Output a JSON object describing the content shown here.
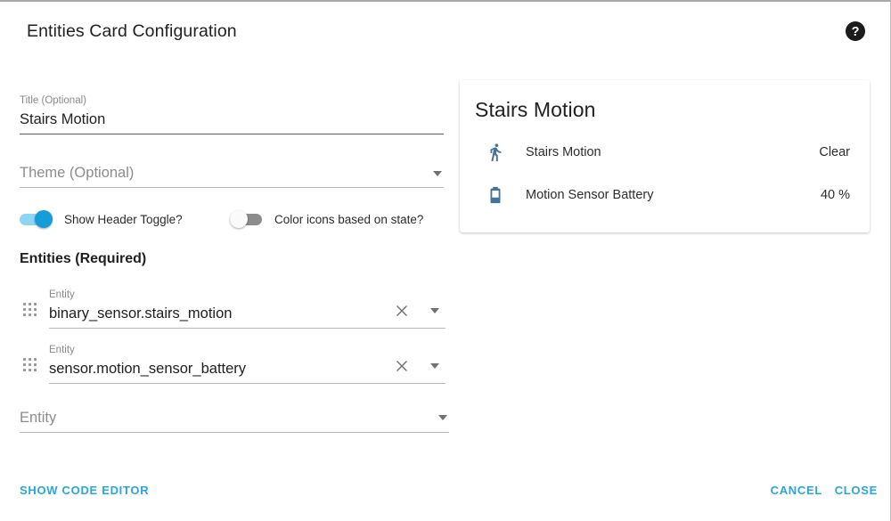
{
  "dialog": {
    "title": "Entities Card Configuration",
    "help_icon": "help-circle-icon"
  },
  "form": {
    "title_field": {
      "label": "Title (Optional)",
      "value": "Stairs Motion"
    },
    "theme_field": {
      "label": "Theme (Optional)",
      "placeholder": "Theme (Optional)",
      "value": "",
      "dropdown_icon": "chevron-down-icon"
    },
    "toggles": [
      {
        "label": "Show Header Toggle?",
        "state": "on",
        "on_color": "#169dd8",
        "track_color": "#8ed5f5"
      },
      {
        "label": "Color icons based on state?",
        "state": "off",
        "off_color": "#8c8c8c"
      }
    ],
    "entities_heading": "Entities (Required)",
    "entity_rows": [
      {
        "label": "Entity",
        "value": "binary_sensor.stairs_motion",
        "clear_icon": "close-icon",
        "dropdown_icon": "chevron-down-icon",
        "drag_icon": "drag-handle-icon"
      },
      {
        "label": "Entity",
        "value": "sensor.motion_sensor_battery",
        "clear_icon": "close-icon",
        "dropdown_icon": "chevron-down-icon",
        "drag_icon": "drag-handle-icon"
      }
    ],
    "entity_empty": {
      "placeholder": "Entity",
      "dropdown_icon": "chevron-down-icon"
    }
  },
  "preview": {
    "title": "Stairs Motion",
    "icon_color": "#44739e",
    "rows": [
      {
        "icon": "walk-icon",
        "name": "Stairs Motion",
        "state": "Clear"
      },
      {
        "icon": "battery-40-icon",
        "name": "Motion Sensor Battery",
        "state": "40 %"
      }
    ]
  },
  "footer": {
    "show_code_editor": "SHOW CODE EDITOR",
    "cancel": "CANCEL",
    "close": "CLOSE",
    "accent_color": "#28a6e0"
  }
}
